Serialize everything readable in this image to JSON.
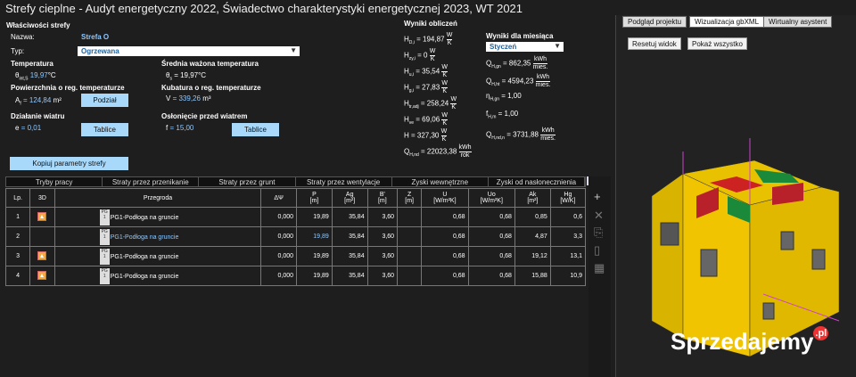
{
  "app": {
    "title": "Strefy cieplne - Audyt energetyczny 2022, Świadectwo charakterystyki energetycznej 2023, WT 2021"
  },
  "props": {
    "header": "Właściwości strefy",
    "name_label": "Nazwa:",
    "name_value": "Strefa O",
    "type_label": "Typ:",
    "type_value": "Ogrzewana",
    "temp_header": "Temperatura",
    "temp_sym": "θ",
    "temp_sub": "int,S",
    "temp_value": "19,97",
    "temp_unit": "°C",
    "avg_header": "Średnia ważona temperatura",
    "avg_sym": "θ",
    "avg_sub": "s",
    "avg_value": "= 19,97",
    "avg_unit": "°C",
    "area_header": "Powierzchnia o reg. temperaturze",
    "area_sym": "A",
    "area_sub": "f",
    "area_value": "= 124,84",
    "area_unit": "m²",
    "split_btn": "Podział",
    "vol_header": "Kubatura o reg. temperaturze",
    "vol_sym": "V",
    "vol_value": "= 339,26",
    "vol_unit": "m³",
    "wind_header": "Działanie wiatru",
    "wind_sym": "e",
    "wind_value": "= 0,01",
    "tables_btn1": "Tablice",
    "shield_header": "Osłonięcie przed wiatrem",
    "shield_sym": "f",
    "shield_value": "= 15,00",
    "tables_btn2": "Tablice",
    "copy_btn": "Kopiuj parametry strefy"
  },
  "results": {
    "header": "Wyniki obliczeń",
    "rows": [
      {
        "sym": "H",
        "sub": "D,i",
        "val": "= 194,87",
        "num": "W",
        "den": "K"
      },
      {
        "sym": "H",
        "sub": "zy,i",
        "val": "= 0",
        "num": "W",
        "den": "K"
      },
      {
        "sym": "H",
        "sub": "u,i",
        "val": "= 35,54",
        "num": "W",
        "den": "K"
      },
      {
        "sym": "H",
        "sub": "g,i",
        "val": "= 27,83",
        "num": "W",
        "den": "K"
      },
      {
        "sym": "H",
        "sub": "tr,adj",
        "val": "= 258,24",
        "num": "W",
        "den": "K"
      },
      {
        "sym": "H",
        "sub": "ve",
        "val": "= 69,06",
        "num": "W",
        "den": "K"
      },
      {
        "sym": "H",
        "sub": "",
        "val": "= 327,30",
        "num": "W",
        "den": "K"
      },
      {
        "sym": "Q",
        "sub": "H,nd",
        "val": "= 22023,38",
        "num": "kWh",
        "den": "rok"
      }
    ]
  },
  "monthly": {
    "header": "Wyniki dla miesiąca",
    "month": "Styczeń",
    "rows": [
      {
        "sym": "Q",
        "sub": "H,gn",
        "val": "= 862,35",
        "num": "kWh",
        "den": "mies."
      },
      {
        "sym": "Q",
        "sub": "H,ht",
        "val": "= 4594,23",
        "num": "kWh",
        "den": "mies."
      },
      {
        "sym": "η",
        "sub": "H,gn",
        "val": "= 1,00",
        "num": "",
        "den": ""
      },
      {
        "sym": "f",
        "sub": "H,m",
        "val": "= 1,00",
        "num": "",
        "den": ""
      },
      {
        "sym": "Q",
        "sub": "H,nd,n",
        "val": "= 3731,88",
        "num": "kWh",
        "den": "mies."
      }
    ]
  },
  "tabs": [
    "Tryby pracy",
    "Straty przez przenikanie",
    "Straty przez grunt",
    "Straty przez wentylacje",
    "Zyski wewnętrzne",
    "Zyski od nasłonecznienia"
  ],
  "table": {
    "headers": [
      "Lp.",
      "3D",
      "Przegroda",
      "ΔΨ",
      "P\n[m]",
      "Ag\n[m²]",
      "B'\n[m]",
      "Z\n[m]",
      "U\n[W/m²K]",
      "Uo\n[W/m²K]",
      "Ak\n[m²]",
      "Hg\n[W/K]"
    ],
    "rows": [
      {
        "lp": "1",
        "pg": "PG\n1",
        "name": "PG1-Podłoga na gruncie",
        "dpsi": "0,000",
        "p": "19,89",
        "ag": "35,84",
        "b": "3,60",
        "z": "",
        "u": "0,68",
        "uo": "0,68",
        "ak": "0,85",
        "hg": "0,6"
      },
      {
        "lp": "2",
        "pg": "PG\n1",
        "name": "PG1-Podłoga na gruncie",
        "dpsi": "0,000",
        "p": "19,89",
        "ag": "35,84",
        "b": "3,60",
        "z": "",
        "u": "0,68",
        "uo": "0,68",
        "ak": "4,87",
        "hg": "3,3"
      },
      {
        "lp": "3",
        "pg": "PG\n1",
        "name": "PG1-Podłoga na gruncie",
        "dpsi": "0,000",
        "p": "19,89",
        "ag": "35,84",
        "b": "3,60",
        "z": "",
        "u": "0,68",
        "uo": "0,68",
        "ak": "19,12",
        "hg": "13,1"
      },
      {
        "lp": "4",
        "pg": "PG\n1",
        "name": "PG1-Podłoga na gruncie",
        "dpsi": "0,000",
        "p": "19,89",
        "ag": "35,84",
        "b": "3,60",
        "z": "",
        "u": "0,68",
        "uo": "0,68",
        "ak": "15,88",
        "hg": "10,9"
      }
    ]
  },
  "right": {
    "tabs": [
      "Podgląd projektu",
      "Wizualizacja gbXML",
      "Wirtualny asystent"
    ],
    "reset_btn": "Resetuj widok",
    "showall_btn": "Pokaż wszystko",
    "watermark": "Sprzedajemy",
    ".pl": "",
    "wm_suffix": ".pl"
  }
}
